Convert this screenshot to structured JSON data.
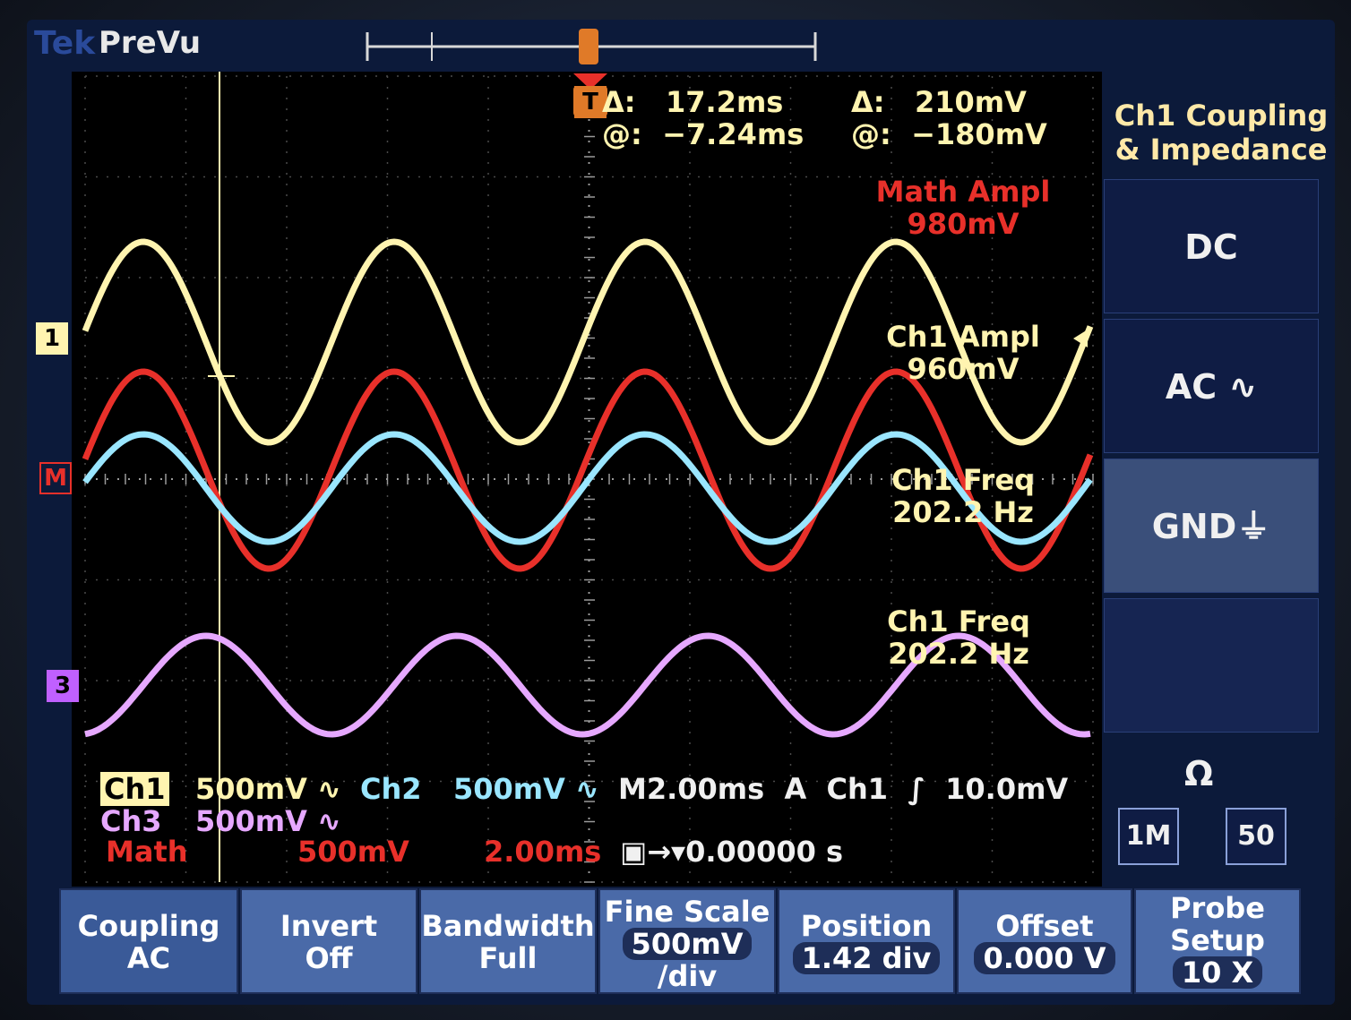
{
  "top": {
    "brand": "Tek",
    "mode": "PreVu"
  },
  "cursor_readout": {
    "delta_time": "Δ:   17.2ms",
    "at_time": "@:  −7.24ms",
    "delta_volt": "Δ:   210mV",
    "at_volt": "@:  −180mV"
  },
  "measurements": [
    {
      "label": "Math Ampl",
      "value": "980mV",
      "color": "#e8302a"
    },
    {
      "label": "Ch1 Ampl",
      "value": "960mV",
      "color": "#fff4b0"
    },
    {
      "label": "Ch1 Freq",
      "value": "202.2 Hz",
      "color": "#fff4b0"
    },
    {
      "label": "Ch1 Freq",
      "value": "202.2 Hz",
      "color": "#fff4b0"
    }
  ],
  "side_menu": {
    "title_line1": "Ch1 Coupling",
    "title_line2": "& Impedance",
    "options": [
      "DC",
      "AC ∿",
      "GND⏚"
    ],
    "impedance_symbol": "Ω",
    "impedance_1m": "1M",
    "impedance_50": "50"
  },
  "markers": {
    "ch1": "1",
    "math": "M",
    "ch3": "3",
    "trigger": "T"
  },
  "status": {
    "ch1": "Ch1",
    "ch1_scale": "500mV ∿",
    "ch2": "Ch2",
    "ch2_scale": "500mV ∿",
    "timebase": "M2.00ms  A  Ch1  ∫  10.0mV",
    "ch3": "Ch3",
    "ch3_scale": "500mV ∿",
    "math": "Math",
    "math_scale": "500mV",
    "math_time": "2.00ms",
    "trig_pos": "0.00000 s"
  },
  "bottom_menu": [
    {
      "label": "Coupling",
      "value": "AC"
    },
    {
      "label": "Invert",
      "value": "Off"
    },
    {
      "label": "Bandwidth",
      "value": "Full"
    },
    {
      "label": "Fine Scale",
      "value": "500mV",
      "value2": "/div"
    },
    {
      "label": "Position",
      "value": "1.42 div"
    },
    {
      "label": "Offset",
      "value": "0.000 V"
    },
    {
      "label": "Probe Setup",
      "value": "10 X"
    }
  ],
  "colors": {
    "ch1": "#fff4b0",
    "ch2": "#9ae6ff",
    "ch3": "#e6a8ff",
    "math": "#e8302a"
  }
}
